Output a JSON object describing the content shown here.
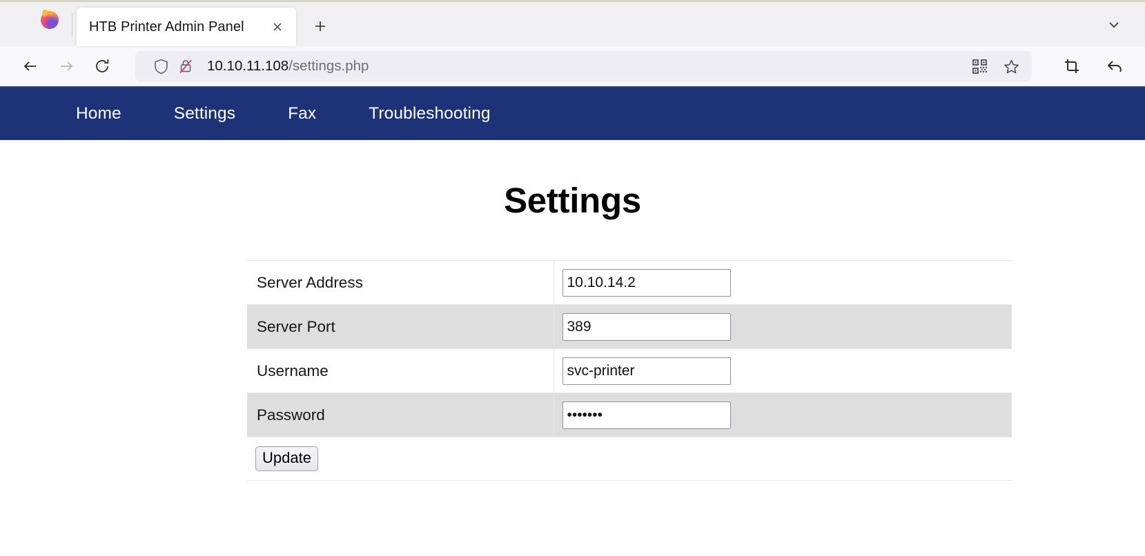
{
  "browser": {
    "tab": {
      "title": "HTB Printer Admin Panel",
      "close_label": "×",
      "favicon": "firefox-logo-icon"
    },
    "new_tab_label": "+",
    "list_all_tabs_label": "v",
    "toolbar": {
      "back_label": "←",
      "forward_label": "→",
      "reload_label": "⟳",
      "back_name": "back-button",
      "forward_name": "forward-button",
      "reload_name": "reload-button"
    },
    "url": {
      "host": "10.10.11.108",
      "path": "/settings.php",
      "shield_icon": "tracking-protection-shield-icon",
      "lock_icon": "insecure-connection-icon",
      "qr_icon": "qr-code-icon",
      "bookmark_icon": "bookmark-star-icon"
    },
    "extras": {
      "screenshot_icon": "screenshot-crop-icon",
      "undo_icon": "undo-arrow-icon"
    }
  },
  "site": {
    "nav": [
      {
        "label": "Home",
        "name": "nav-link-home"
      },
      {
        "label": "Settings",
        "name": "nav-link-settings"
      },
      {
        "label": "Fax",
        "name": "nav-link-fax"
      },
      {
        "label": "Troubleshooting",
        "name": "nav-link-troubleshooting"
      }
    ],
    "nav_bg": "#1e3278",
    "title": "Settings",
    "form": {
      "rows": [
        {
          "label": "Server Address",
          "value": "10.10.14.2",
          "type": "text",
          "field_name": "server-address-input"
        },
        {
          "label": "Server Port",
          "value": "389",
          "type": "text",
          "field_name": "server-port-input"
        },
        {
          "label": "Username",
          "value": "svc-printer",
          "type": "text",
          "field_name": "username-input"
        },
        {
          "label": "Password",
          "value": "*******",
          "type": "password",
          "field_name": "password-input"
        }
      ],
      "submit_label": "Update"
    }
  }
}
